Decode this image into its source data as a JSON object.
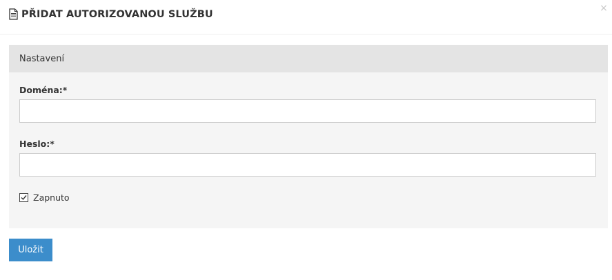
{
  "modal": {
    "title": "PŘIDAT AUTORIZOVANOU SLUŽBU",
    "title_icon": "document-icon",
    "close_label": "×"
  },
  "panel": {
    "heading": "Nastavení",
    "domain": {
      "label": "Doména:*",
      "value": "",
      "placeholder": ""
    },
    "password": {
      "label": "Heslo:*",
      "value": "",
      "placeholder": ""
    },
    "enabled": {
      "label": "Zapnuto",
      "checked": true
    }
  },
  "actions": {
    "save_label": "Uložit"
  },
  "colors": {
    "accent": "#3c8dcb",
    "panel_bg": "#f5f5f5",
    "panel_heading_bg": "#e4e4e4"
  }
}
